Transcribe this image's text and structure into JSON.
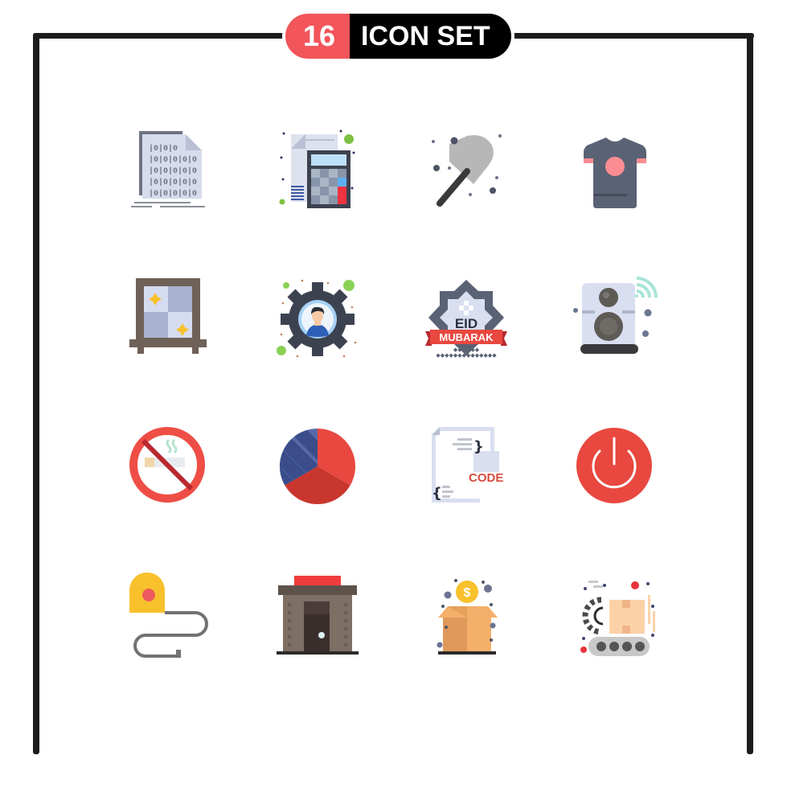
{
  "header": {
    "count": "16",
    "title": "ICON SET"
  },
  "icons": [
    {
      "name": "binary-code-document",
      "label": ""
    },
    {
      "name": "accounting-calculator",
      "label": ""
    },
    {
      "name": "shovel",
      "label": ""
    },
    {
      "name": "t-shirt",
      "label": ""
    },
    {
      "name": "window",
      "label": ""
    },
    {
      "name": "user-settings-gear",
      "label": ""
    },
    {
      "name": "eid-mubarak-badge",
      "label": "EID",
      "sublabel": "MUBARAK"
    },
    {
      "name": "wireless-speaker",
      "label": ""
    },
    {
      "name": "no-smoking",
      "label": ""
    },
    {
      "name": "pie-chart",
      "label": ""
    },
    {
      "name": "code-document",
      "label": "CODE"
    },
    {
      "name": "power-button",
      "label": ""
    },
    {
      "name": "measuring-tape",
      "label": ""
    },
    {
      "name": "shop-building",
      "label": ""
    },
    {
      "name": "money-box",
      "label": "$"
    },
    {
      "name": "conveyor-package-automation",
      "label": ""
    }
  ],
  "colors": {
    "accent": "#f2555a",
    "dark": "#1c1c1c",
    "slate": "#5a6275",
    "light_blue": "#d9dff0",
    "red": "#e8483f",
    "green": "#7dc242",
    "orange": "#f4b06b",
    "yellow": "#f8c12c"
  }
}
